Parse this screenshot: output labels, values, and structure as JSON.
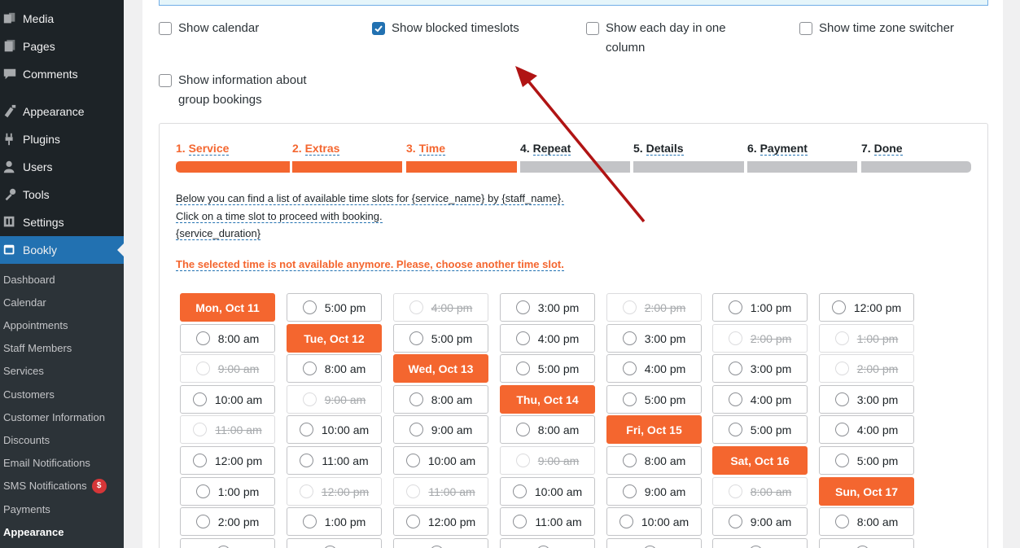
{
  "sidebar": {
    "menu": [
      {
        "label": "Media",
        "icon": "media-icon"
      },
      {
        "label": "Pages",
        "icon": "pages-icon"
      },
      {
        "label": "Comments",
        "icon": "comments-icon"
      },
      {
        "label": "Appearance",
        "icon": "appearance-icon"
      },
      {
        "label": "Plugins",
        "icon": "plugins-icon"
      },
      {
        "label": "Users",
        "icon": "users-icon"
      },
      {
        "label": "Tools",
        "icon": "tools-icon"
      },
      {
        "label": "Settings",
        "icon": "settings-icon"
      },
      {
        "label": "Bookly",
        "icon": "bookly-icon",
        "active": true
      }
    ],
    "submenu": [
      {
        "label": "Dashboard"
      },
      {
        "label": "Calendar"
      },
      {
        "label": "Appointments"
      },
      {
        "label": "Staff Members"
      },
      {
        "label": "Services"
      },
      {
        "label": "Customers"
      },
      {
        "label": "Customer Information"
      },
      {
        "label": "Discounts"
      },
      {
        "label": "Email Notifications"
      },
      {
        "label": "SMS Notifications",
        "badge": "$"
      },
      {
        "label": "Payments"
      },
      {
        "label": "Appearance",
        "current": true
      }
    ]
  },
  "options": [
    {
      "label": "Show calendar",
      "checked": false
    },
    {
      "label": "Show blocked timeslots",
      "checked": true
    },
    {
      "label_line1": "Show each day in one",
      "label_line2": "column",
      "checked": false
    },
    {
      "label": "Show time zone switcher",
      "checked": false
    },
    {
      "label_line1": "Show information about",
      "label_line2": "group bookings",
      "checked": false
    }
  ],
  "steps": [
    {
      "num": "1.",
      "label": "Service",
      "done": true
    },
    {
      "num": "2.",
      "label": "Extras",
      "done": true
    },
    {
      "num": "3.",
      "label": "Time",
      "done": true
    },
    {
      "num": "4.",
      "label": "Repeat",
      "done": false
    },
    {
      "num": "5.",
      "label": "Details",
      "done": false
    },
    {
      "num": "6.",
      "label": "Payment",
      "done": false
    },
    {
      "num": "7.",
      "label": "Done",
      "done": false
    }
  ],
  "info": {
    "line1": "Below you can find a list of available time slots for {service_name} by {staff_name}.",
    "line2": "Click on a time slot to proceed with booking.",
    "line3": "{service_duration}",
    "error": "The selected time is not available anymore. Please, choose another time slot."
  },
  "slots": [
    [
      {
        "t": "Mon, Oct 11",
        "k": "day"
      },
      {
        "t": "8:00 am"
      },
      {
        "t": "9:00 am",
        "k": "blocked"
      },
      {
        "t": "10:00 am"
      },
      {
        "t": "11:00 am",
        "k": "blocked"
      },
      {
        "t": "12:00 pm"
      },
      {
        "t": "1:00 pm"
      },
      {
        "t": "2:00 pm"
      },
      {
        "t": ""
      }
    ],
    [
      {
        "t": "5:00 pm"
      },
      {
        "t": "Tue, Oct 12",
        "k": "day"
      },
      {
        "t": "8:00 am"
      },
      {
        "t": "9:00 am",
        "k": "blocked"
      },
      {
        "t": "10:00 am"
      },
      {
        "t": "11:00 am"
      },
      {
        "t": "12:00 pm",
        "k": "blocked"
      },
      {
        "t": "1:00 pm"
      },
      {
        "t": ""
      }
    ],
    [
      {
        "t": "4:00 pm",
        "k": "blocked"
      },
      {
        "t": "5:00 pm"
      },
      {
        "t": "Wed, Oct 13",
        "k": "day"
      },
      {
        "t": "8:00 am"
      },
      {
        "t": "9:00 am"
      },
      {
        "t": "10:00 am"
      },
      {
        "t": "11:00 am",
        "k": "blocked"
      },
      {
        "t": "12:00 pm"
      },
      {
        "t": ""
      }
    ],
    [
      {
        "t": "3:00 pm"
      },
      {
        "t": "4:00 pm"
      },
      {
        "t": "5:00 pm"
      },
      {
        "t": "Thu, Oct 14",
        "k": "day"
      },
      {
        "t": "8:00 am"
      },
      {
        "t": "9:00 am",
        "k": "blocked"
      },
      {
        "t": "10:00 am"
      },
      {
        "t": "11:00 am"
      },
      {
        "t": ""
      }
    ],
    [
      {
        "t": "2:00 pm",
        "k": "blocked"
      },
      {
        "t": "3:00 pm"
      },
      {
        "t": "4:00 pm"
      },
      {
        "t": "5:00 pm"
      },
      {
        "t": "Fri, Oct 15",
        "k": "day"
      },
      {
        "t": "8:00 am"
      },
      {
        "t": "9:00 am"
      },
      {
        "t": "10:00 am"
      },
      {
        "t": ""
      }
    ],
    [
      {
        "t": "1:00 pm"
      },
      {
        "t": "2:00 pm",
        "k": "blocked"
      },
      {
        "t": "3:00 pm"
      },
      {
        "t": "4:00 pm"
      },
      {
        "t": "5:00 pm"
      },
      {
        "t": "Sat, Oct 16",
        "k": "day"
      },
      {
        "t": "8:00 am",
        "k": "blocked"
      },
      {
        "t": "9:00 am"
      },
      {
        "t": ""
      }
    ],
    [
      {
        "t": "12:00 pm"
      },
      {
        "t": "1:00 pm",
        "k": "blocked"
      },
      {
        "t": "2:00 pm",
        "k": "blocked"
      },
      {
        "t": "3:00 pm"
      },
      {
        "t": "4:00 pm"
      },
      {
        "t": "5:00 pm"
      },
      {
        "t": "Sun, Oct 17",
        "k": "day"
      },
      {
        "t": "8:00 am"
      },
      {
        "t": ""
      }
    ]
  ],
  "colors": {
    "accent": "#f4662f",
    "sidebar": "#1d2327",
    "active": "#2271b1",
    "annotation_arrow": "#b01414"
  }
}
